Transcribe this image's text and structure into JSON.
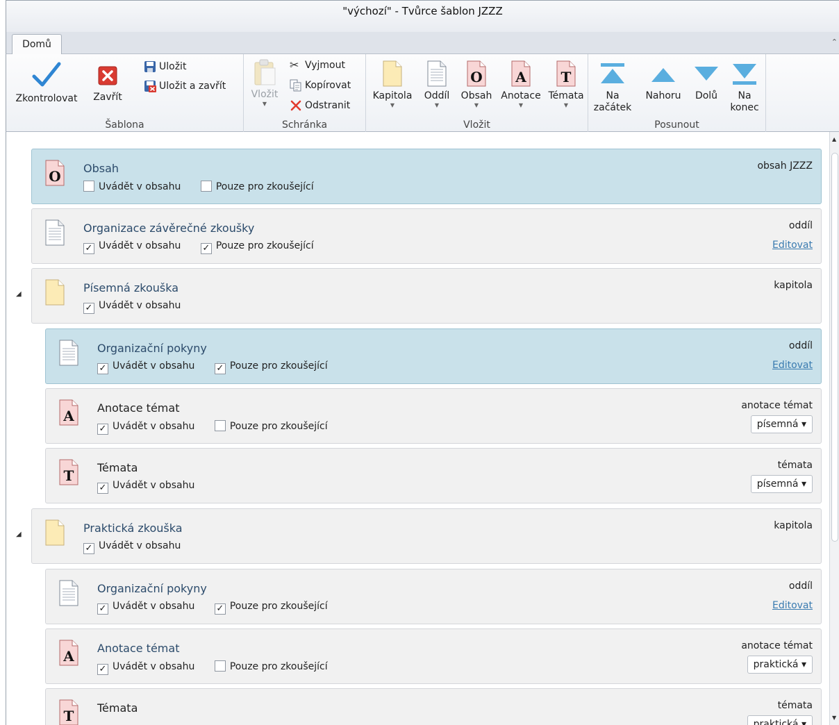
{
  "window": {
    "title": "\"výchozí\" - Tvůrce šablon JZZZ"
  },
  "tabs": [
    {
      "label": "Domů"
    }
  ],
  "colors": {
    "selected_bg": "#c9e1ea",
    "card_bg": "#f1f1f1",
    "link": "#3a7bb0",
    "arrow_blue": "#5aaedf"
  },
  "ribbon": {
    "sablona": {
      "label": "Šablona",
      "check": "Zkontrolovat",
      "close": "Zavřít",
      "save": "Uložit",
      "save_close": "Uložit a zavřít"
    },
    "schranka": {
      "label": "Schránka",
      "paste": "Vložit",
      "cut": "Vyjmout",
      "copy": "Kopírovat",
      "delete": "Odstranit"
    },
    "vlozit": {
      "label": "Vložit",
      "chapter": "Kapitola",
      "section": "Oddíl",
      "toc": "Obsah",
      "annotation": "Anotace",
      "topics": "Témata"
    },
    "posunout": {
      "label": "Posunout",
      "to_start_1": "Na",
      "to_start_2": "začátek",
      "up": "Nahoru",
      "down": "Dolů",
      "to_end_1": "Na",
      "to_end_2": "konec"
    }
  },
  "items": [
    {
      "icon": "toc-icon",
      "title": "Obsah",
      "type": "obsah JZZZ",
      "in_toc_label": "Uvádět v obsahu",
      "in_toc": false,
      "examiner_label": "Pouze pro zkoušející",
      "examiner": false,
      "selected": true
    },
    {
      "icon": "section-icon",
      "title": "Organizace závěrečné zkoušky",
      "type": "oddíl",
      "edit": "Editovat",
      "in_toc_label": "Uvádět v obsahu",
      "in_toc": true,
      "examiner_label": "Pouze pro zkoušející",
      "examiner": true
    },
    {
      "icon": "chapter-icon",
      "title": "Písemná zkouška",
      "type": "kapitola",
      "in_toc_label": "Uvádět v obsahu",
      "in_toc": true,
      "expanded": true
    },
    {
      "icon": "section-icon",
      "title": "Organizační pokyny",
      "type": "oddíl",
      "edit": "Editovat",
      "in_toc_label": "Uvádět v obsahu",
      "in_toc": true,
      "examiner_label": "Pouze pro zkoušející",
      "examiner": true,
      "selected": true
    },
    {
      "icon": "annotation-icon",
      "title": "Anotace témat",
      "type": "anotace témat",
      "combo": "písemná",
      "in_toc_label": "Uvádět v obsahu",
      "in_toc": true,
      "examiner_label": "Pouze pro zkoušející",
      "examiner": false
    },
    {
      "icon": "topics-icon",
      "title": "Témata",
      "type": "témata",
      "combo": "písemná",
      "in_toc_label": "Uvádět v obsahu",
      "in_toc": true
    },
    {
      "icon": "chapter-icon",
      "title": "Praktická zkouška",
      "type": "kapitola",
      "in_toc_label": "Uvádět v obsahu",
      "in_toc": true,
      "expanded": true
    },
    {
      "icon": "section-icon",
      "title": "Organizační pokyny",
      "type": "oddíl",
      "edit": "Editovat",
      "in_toc_label": "Uvádět v obsahu",
      "in_toc": true,
      "examiner_label": "Pouze pro zkoušející",
      "examiner": true
    },
    {
      "icon": "annotation-icon",
      "title": "Anotace témat",
      "type": "anotace témat",
      "combo": "praktická",
      "in_toc_label": "Uvádět v obsahu",
      "in_toc": true,
      "examiner_label": "Pouze pro zkoušející",
      "examiner": false
    },
    {
      "icon": "topics-icon",
      "title": "Témata",
      "type": "témata",
      "combo": "praktická"
    }
  ],
  "checkmark": "✓",
  "dropdown_arrow": "▾"
}
